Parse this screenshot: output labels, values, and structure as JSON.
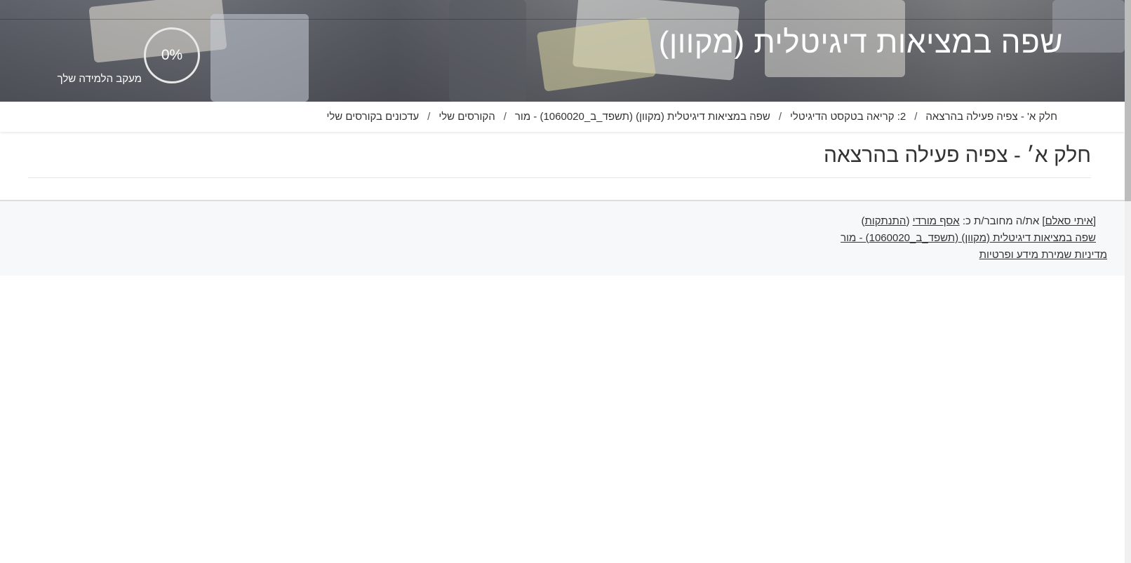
{
  "header": {
    "course_title": "שפה במציאות דיגיטלית (מקוון)",
    "progress_value": "0%",
    "progress_label": "מעקב הלמידה שלך"
  },
  "breadcrumb": {
    "items": [
      "עדכונים בקורסים שלי",
      "הקורסים שלי",
      "שפה במציאות דיגיטלית (מקוון) (תשפד_ב_1060020) - מור",
      "2: קריאה בטקסט הדיגיטלי",
      "חלק א' - צפיה פעילה בהרצאה"
    ],
    "separator": "/"
  },
  "main": {
    "page_heading": "חלק א׳ - צפיה פעילה בהרצאה"
  },
  "footer": {
    "impersonator_name": "איתי סאלם",
    "logged_in_as_text": "את/ה מחובר/ת כ:",
    "user_name": "אסף מורדי",
    "logout_label": "התנתקות",
    "course_link": "שפה במציאות דיגיטלית (מקוון) (תשפד_ב_1060020) - מור",
    "privacy_link": "מדיניות שמירת מידע ופרטיות"
  }
}
